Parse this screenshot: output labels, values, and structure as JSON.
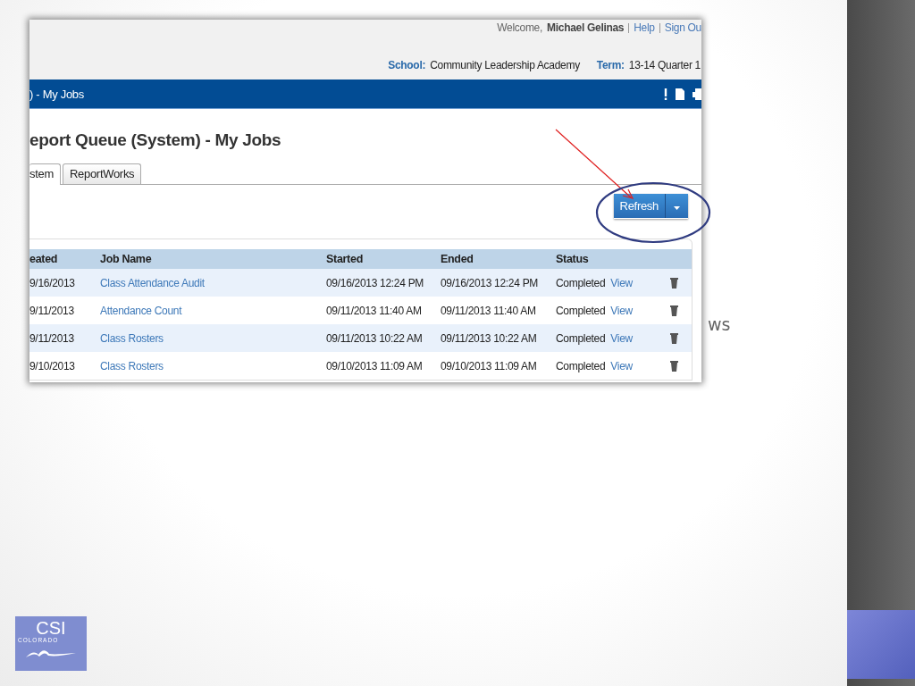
{
  "slide_text": "ws",
  "screenshot": {
    "welcome": {
      "label": "Welcome,",
      "user": "Michael Gelinas",
      "links": [
        "Help",
        "Sign Ou"
      ]
    },
    "context": [
      {
        "label": "School:",
        "value": "Community Leadership Academy"
      },
      {
        "label": "Term:",
        "value": "13-14 Quarter 1"
      }
    ],
    "bar_title": ") - My Jobs",
    "page_title": "eport Queue (System) - My Jobs",
    "tabs": [
      {
        "label": "stem",
        "selected": true
      },
      {
        "label": "ReportWorks",
        "selected": false
      }
    ],
    "refresh_button": "Refresh",
    "table": {
      "columns": [
        "eated",
        "Job Name",
        "Started",
        "Ended",
        "Status"
      ],
      "rows": [
        {
          "created": "9/16/2013",
          "job_name": "Class Attendance Audit",
          "started": "09/16/2013 12:24 PM",
          "ended": "09/16/2013 12:24 PM",
          "status": "Completed",
          "action": "View"
        },
        {
          "created": "9/11/2013",
          "job_name": "Attendance Count",
          "started": "09/11/2013 11:40 AM",
          "ended": "09/11/2013 11:40 AM",
          "status": "Completed",
          "action": "View"
        },
        {
          "created": "9/11/2013",
          "job_name": "Class Rosters",
          "started": "09/11/2013 10:22 AM",
          "ended": "09/11/2013 10:22 AM",
          "status": "Completed",
          "action": "View"
        },
        {
          "created": "9/10/2013",
          "job_name": "Class Rosters",
          "started": "09/10/2013 11:09 AM",
          "ended": "09/10/2013 11:09 AM",
          "status": "Completed",
          "action": "View"
        }
      ]
    }
  },
  "logo": {
    "title": "CSI",
    "subtitle": "COLORADO"
  }
}
